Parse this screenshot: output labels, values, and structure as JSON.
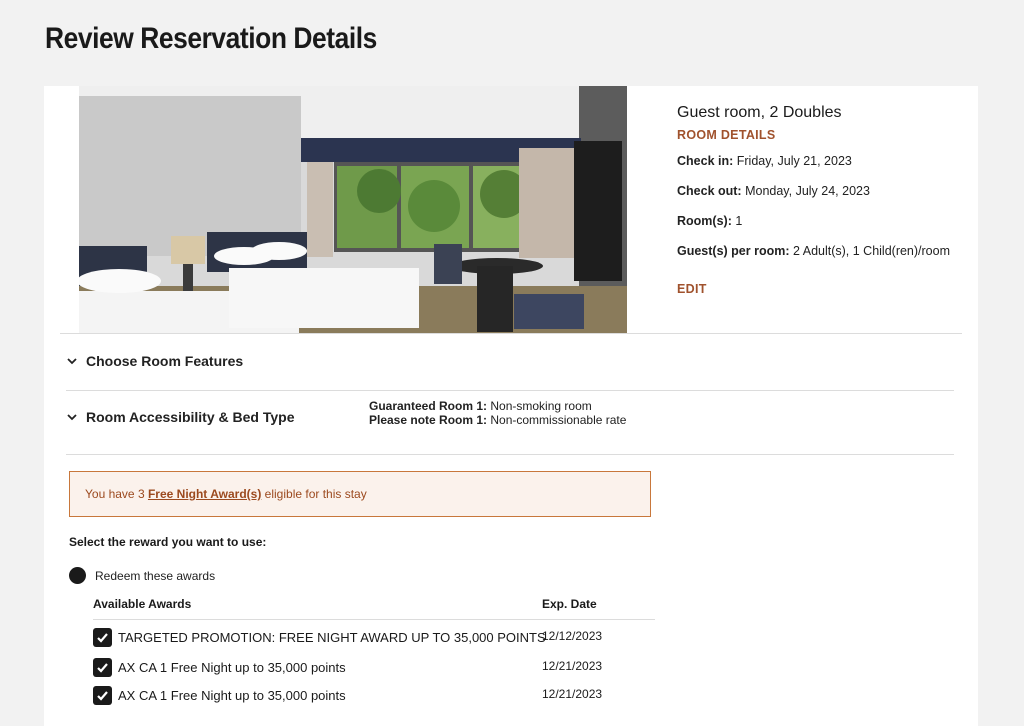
{
  "page_title": "Review Reservation Details",
  "room": {
    "name": "Guest room, 2 Doubles",
    "details_link": "ROOM DETAILS",
    "check_in_label": "Check in:",
    "check_in_value": "Friday, July 21, 2023",
    "check_out_label": "Check out:",
    "check_out_value": "Monday, July 24, 2023",
    "rooms_label": "Room(s):",
    "rooms_value": "1",
    "guests_label": "Guest(s) per room:",
    "guests_value": "2 Adult(s), 1 Child(ren)/room",
    "edit_link": "EDIT"
  },
  "sections": {
    "room_features": "Choose Room Features",
    "accessibility": "Room Accessibility & Bed Type"
  },
  "notes": {
    "guaranteed_label": "Guaranteed Room 1:",
    "guaranteed_value": "Non-smoking room",
    "please_note_label": "Please note Room 1:",
    "please_note_value": "Non-commissionable rate"
  },
  "award_banner": {
    "prefix": "You have 3",
    "link": "Free Night Award(s)",
    "suffix": "eligible for this stay"
  },
  "reward_select": {
    "label": "Select the reward you want to use:",
    "option": "Redeem these awards"
  },
  "awards_table": {
    "col_awards": "Available Awards",
    "col_exp": "Exp. Date",
    "rows": [
      {
        "name": "TARGETED PROMOTION: FREE NIGHT AWARD UP TO 35,000 POINTS",
        "exp": "12/12/2023"
      },
      {
        "name": "AX CA 1 Free Night up to 35,000 points",
        "exp": "12/21/2023"
      },
      {
        "name": "AX CA 1 Free Night up to 35,000 points",
        "exp": "12/21/2023"
      }
    ]
  },
  "colors": {
    "accent": "#a0522d",
    "banner_bg": "#fbf2ec",
    "banner_border": "#c8773b",
    "page_bg": "#f2f2f2"
  },
  "icons": {
    "chevron": "chevron-down-icon",
    "check": "checkmark-icon"
  }
}
